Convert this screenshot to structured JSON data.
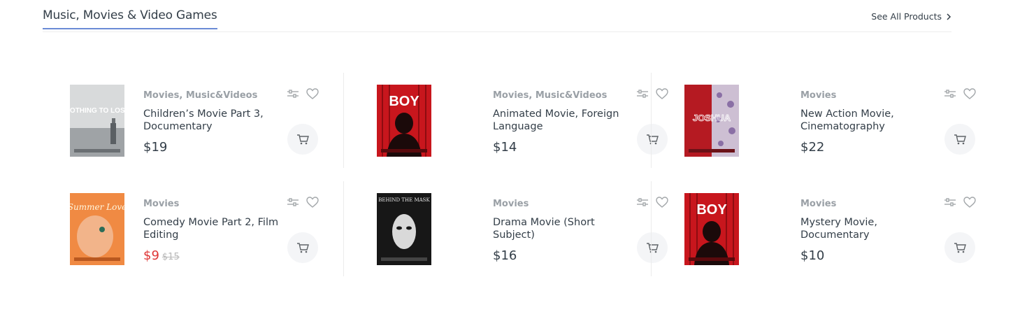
{
  "section": {
    "title": "Music, Movies & Video Games",
    "see_all_label": "See All Products"
  },
  "colors": {
    "accent_underline": "#6b8bd6",
    "sale_price": "#df3737",
    "text": "#333e48",
    "muted": "#9aa0a6"
  },
  "products": [
    {
      "category": "Movies, Music&Videos",
      "title": "Children’s Movie Part 3, Documentary",
      "price": "$19",
      "old_price": "",
      "poster_text": "NOTHING TO LOSE",
      "poster_theme": "gray"
    },
    {
      "category": "Movies, Music&Videos",
      "title": "Animated Movie, Foreign Language",
      "price": "$14",
      "old_price": "",
      "poster_text": "BOY",
      "poster_theme": "red"
    },
    {
      "category": "Movies",
      "title": "New Action Movie, Cinematography",
      "price": "$22",
      "old_price": "",
      "poster_text": "JOSHUA",
      "poster_theme": "red-floral"
    },
    {
      "category": "Movies",
      "title": "Comedy Movie Part 2, Film Editing",
      "price": "$9",
      "old_price": "$15",
      "poster_text": "Summer Love",
      "poster_theme": "orange"
    },
    {
      "category": "Movies",
      "title": "Drama Movie (Short Subject)",
      "price": "$16",
      "old_price": "",
      "poster_text": "BEHIND THE MASK",
      "poster_theme": "dark"
    },
    {
      "category": "Movies",
      "title": "Mystery Movie, Documentary",
      "price": "$10",
      "old_price": "",
      "poster_text": "BOY",
      "poster_theme": "red"
    }
  ],
  "icons": {
    "compare": "sliders-icon",
    "wishlist": "heart-icon",
    "cart": "cart-icon",
    "see_all": "chevron-right-icon"
  }
}
